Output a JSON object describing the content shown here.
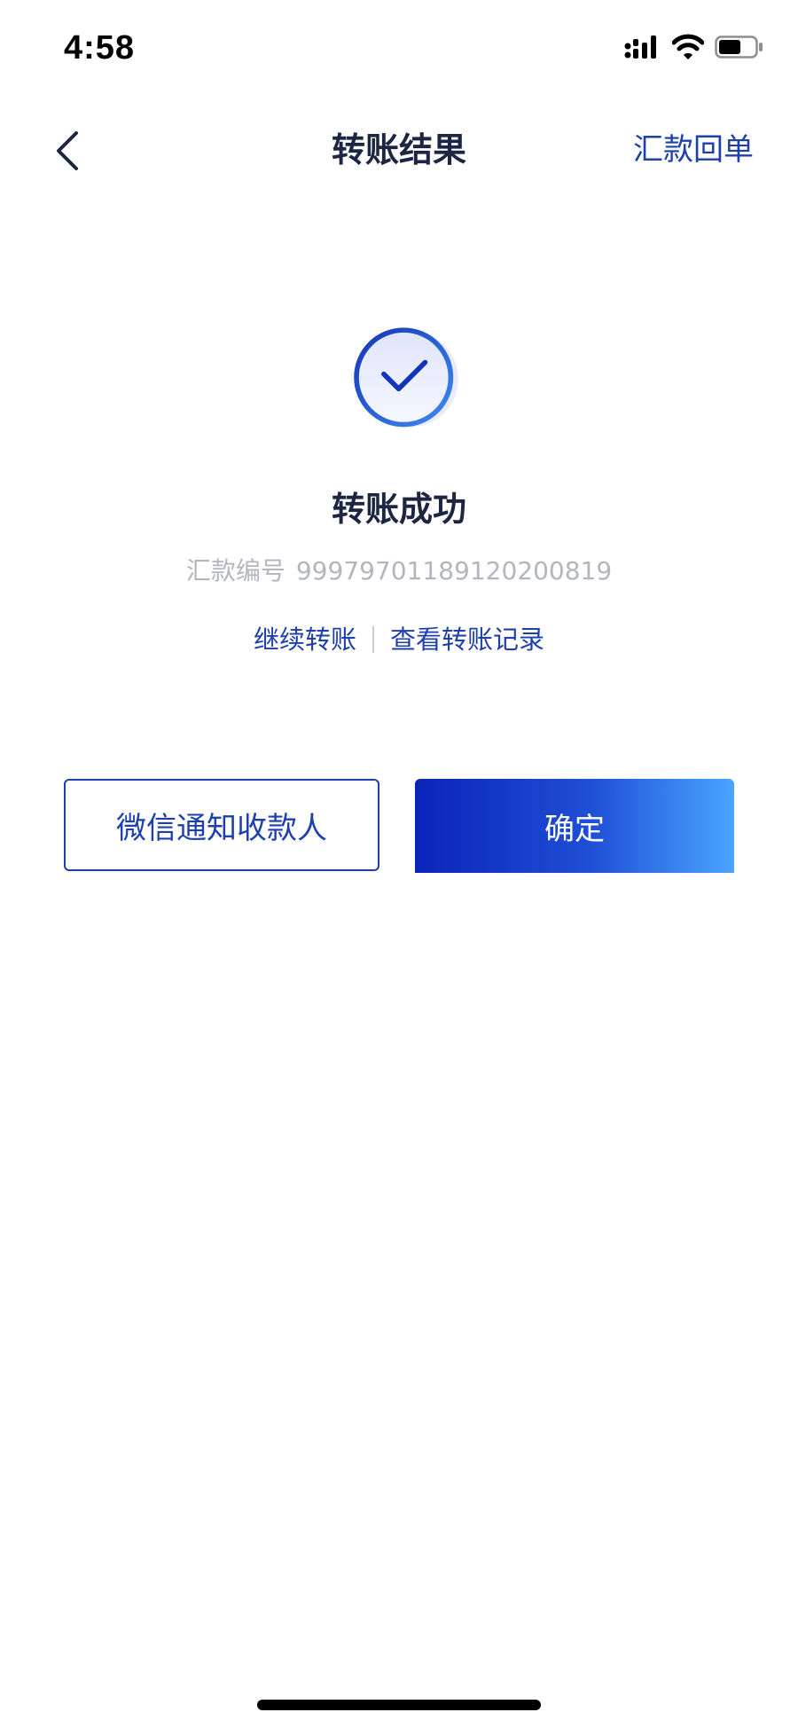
{
  "status_bar": {
    "time": "4:58",
    "icons": [
      "signal-icon",
      "wifi-icon",
      "battery-icon"
    ]
  },
  "nav": {
    "title": "转账结果",
    "action_label": "汇款回单",
    "back_icon": "chevron-left-icon"
  },
  "result": {
    "icon": "check-circle-icon",
    "title": "转账成功",
    "remit_label": "汇款编号",
    "remit_number": "9997970118912020081​9",
    "links": {
      "continue": "继续转账",
      "records": "查看转账记录"
    }
  },
  "buttons": {
    "notify": "微信通知收款人",
    "confirm": "确定"
  },
  "colors": {
    "accent": "#1e3fae",
    "title": "#1c2541",
    "muted": "#b3b6bf",
    "gradient_start": "#0a24b8",
    "gradient_end": "#4aa5ff"
  }
}
